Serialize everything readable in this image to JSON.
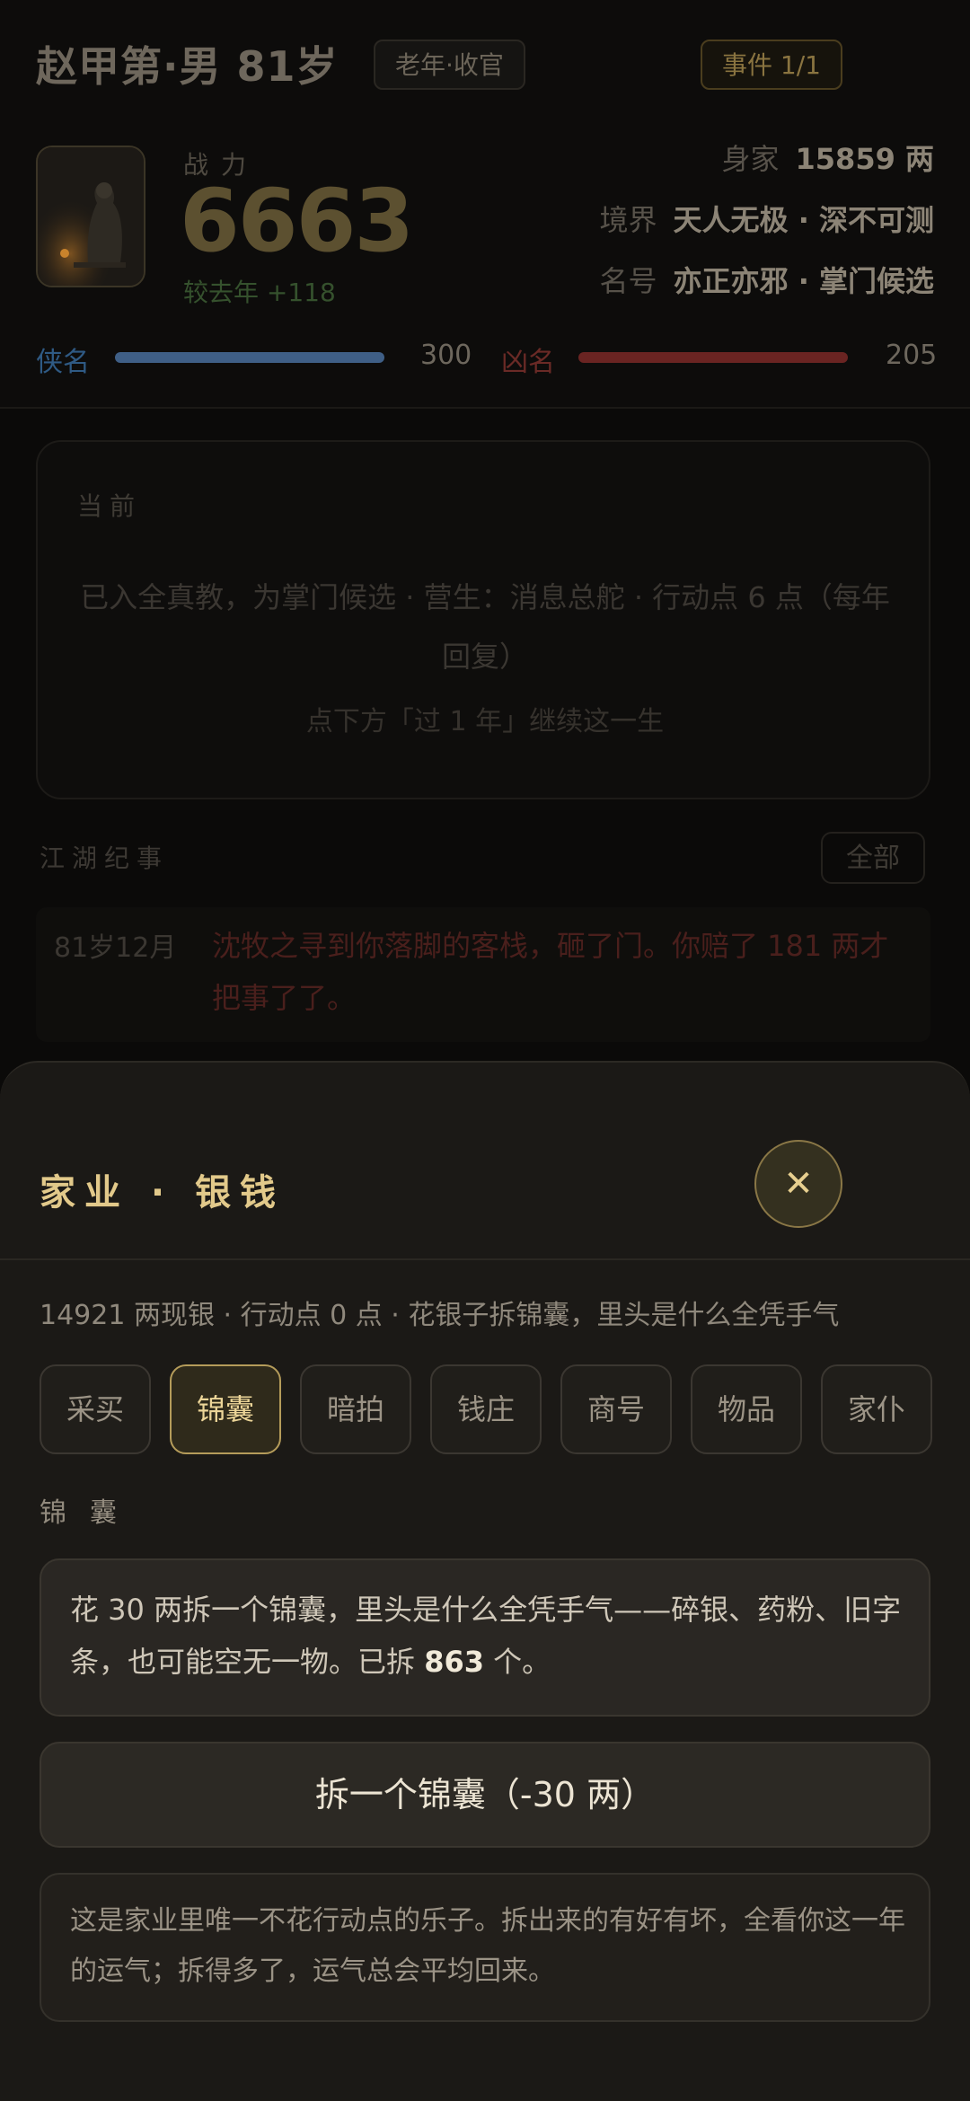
{
  "header": {
    "name": "赵甲第·男 81岁",
    "stage_tag": "老年·收官",
    "event_tag": "事件 1/1",
    "power_label": "战力",
    "power_value": "6663",
    "power_delta": "较去年 +118",
    "stats": [
      {
        "label": "身家",
        "value": "15859 两"
      },
      {
        "label": "境界",
        "value": "天人无极 · 深不可测"
      },
      {
        "label": "名号",
        "value": "亦正亦邪 · 掌门候选"
      }
    ],
    "fame": {
      "good_label": "侠名",
      "good_value": "300",
      "good_fraction": 1.0,
      "bad_label": "凶名",
      "bad_value": "205",
      "bad_fraction": 1.0
    },
    "colors": {
      "good": "#3f5f86",
      "bad": "#6a2422"
    }
  },
  "current": {
    "heading": "当前",
    "text": "已入全真教，为掌门候选 · 营生：消息总舵 · 行动点 6 点（每年回复）",
    "hint": "点下方「过 1 年」继续这一生"
  },
  "chronicle": {
    "title": "江湖纪事",
    "all_button": "全部",
    "items": [
      {
        "age": "81岁12月",
        "text": "沈牧之寻到你落脚的客栈，砸了门。你赔了 181 两才把事了了。"
      }
    ]
  },
  "sheet": {
    "title": "家业 · 银钱",
    "close_icon": "close-x-icon",
    "subtitle": "14921 两现银 · 行动点 0 点 · 花银子拆锦囊，里头是什么全凭手气",
    "tabs": [
      "采买",
      "锦囊",
      "暗拍",
      "钱庄",
      "商号",
      "物品",
      "家仆"
    ],
    "active_tab": "锦囊",
    "section_label": "锦囊",
    "info_prefix": "花 30 两拆一个锦囊，里头是什么全凭手气——碎银、药粉、旧字条，也可能空无一物。已拆 ",
    "info_count": "863",
    "info_suffix": " 个。",
    "open_button": "拆一个锦囊（-30 两）",
    "note": "这是家业里唯一不花行动点的乐子。拆出来的有好有坏，全看你这一年的运气；拆得多了，运气总会平均回来。"
  }
}
